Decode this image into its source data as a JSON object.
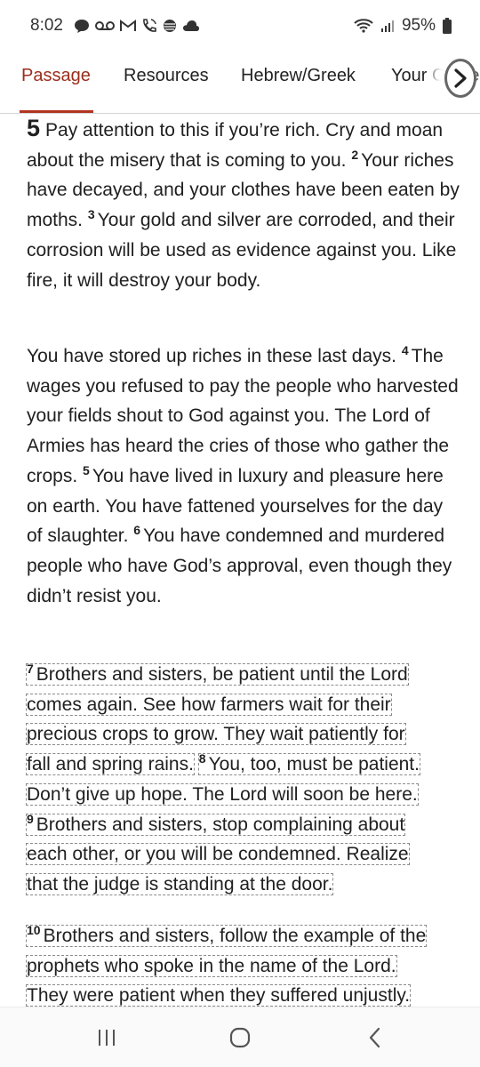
{
  "status_bar": {
    "time": "8:02",
    "battery": "95%",
    "icons": [
      "chat-bubble-icon",
      "voicemail-icon",
      "gmail-icon",
      "wifi-calling-icon",
      "att-icon",
      "cloud-icon",
      "wifi-icon",
      "signal-icon",
      "battery-icon"
    ]
  },
  "tabs": [
    {
      "label": "Passage",
      "active": true
    },
    {
      "label": "Resources",
      "active": false
    },
    {
      "label": "Hebrew/Greek",
      "active": false
    },
    {
      "label": "Your Content",
      "active": false
    }
  ],
  "colors": {
    "accent": "#b2341f",
    "tab_active": "#9b2d1c",
    "text": "#202020"
  },
  "passage": {
    "p1": {
      "chapter": "5",
      "v1_text": "Pay attention to this if you’re rich. Cry and moan about the misery that is coming to you.",
      "v2_num": "2",
      "v2_text": "Your riches have decayed, and your clothes have been eaten by moths.",
      "v3_num": "3",
      "v3_text": "Your gold and silver are corroded, and their corrosion will be used as evidence against you. Like fire, it will destroy your body."
    },
    "p2": {
      "v3b_text": "You have stored up riches in these last days.",
      "v4_num": "4",
      "v4_text": "The wages you refused to pay the people who harvested your fields shout to God against you. The Lord of Armies has heard the cries of those who gather the crops.",
      "v5_num": "5",
      "v5_text": "You have lived in luxury and pleasure here on earth. You have fattened yourselves for the day of slaughter.",
      "v6_num": "6",
      "v6_text": "You have condemned and murdered people who have God’s approval, even though they didn’t resist you."
    },
    "p3": {
      "v7_num": "7",
      "lines": [
        "Brothers and sisters, be patient until the Lord",
        "comes again. See how farmers wait for their",
        "precious crops to grow. They wait patiently for",
        "fall and spring rains.",
        "You, too, must be patient.",
        "Don’t give up hope. The Lord will soon be here.",
        "Brothers and sisters, stop complaining about",
        "each other, or you will be condemned. Realize",
        "that the judge is standing at the door."
      ],
      "v8_num": "8",
      "v9_num": "9"
    },
    "p4": {
      "v10_num": "10",
      "lines": [
        "Brothers and sisters, follow the example of the",
        "prophets who spoke in the name of the Lord.",
        "They were patient when they suffered unjustly."
      ]
    }
  },
  "nav_bar": {
    "buttons": [
      "recent-apps",
      "home",
      "back"
    ]
  }
}
